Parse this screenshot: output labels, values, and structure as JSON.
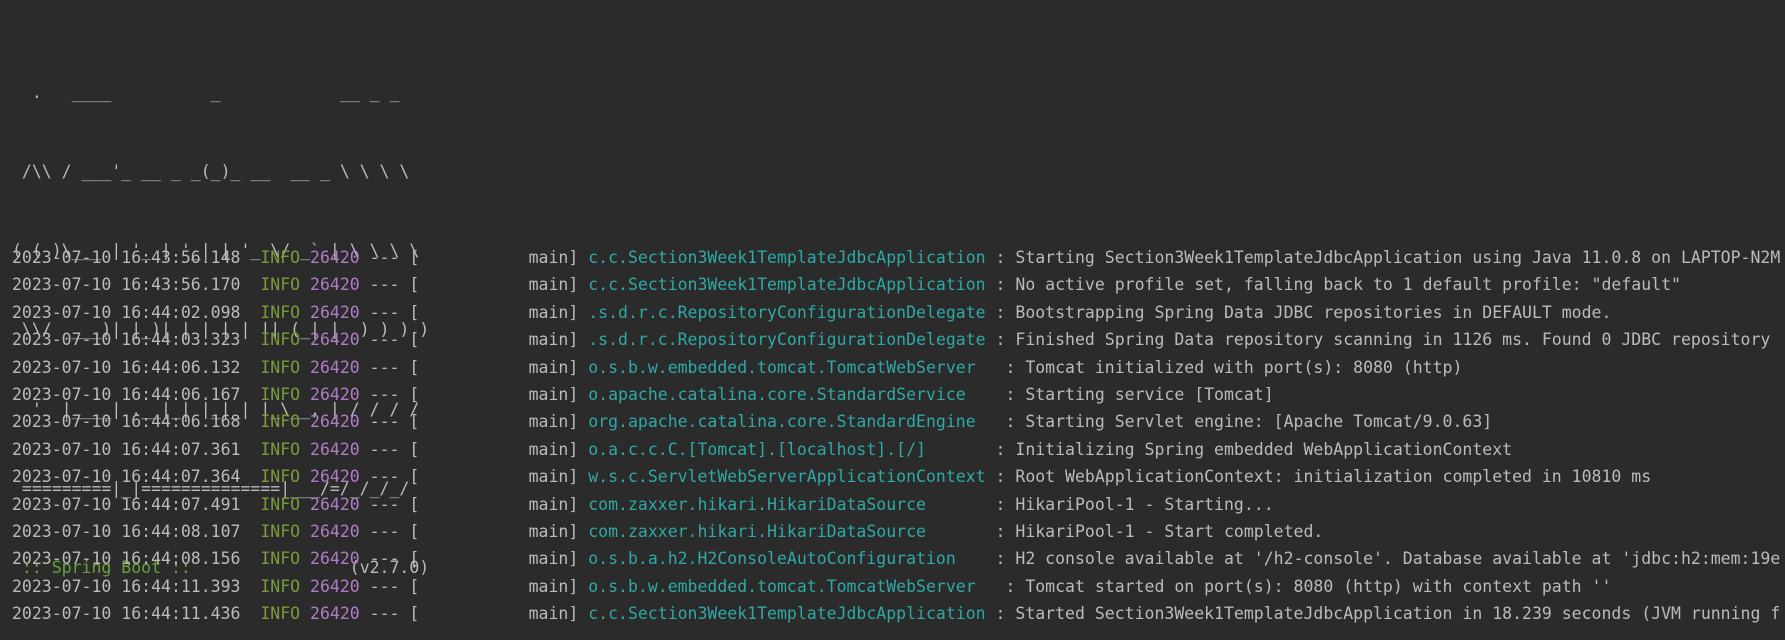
{
  "banner": {
    "lines": [
      "  .   ____          _            __ _ _",
      " /\\\\ / ___'_ __ _ _(_)_ __  __ _ \\ \\ \\ \\",
      "( ( )\\___ | '_ | '_| | '_ \\/ _` | \\ \\ \\ \\",
      " \\\\/  ___)| |_)| | | | | || (_| |  ) ) ) )",
      "  '  |____| .__|_| |_|_| |_\\__, | / / / /",
      " =========|_|==============|___/=/_/_/_/"
    ],
    "spring_label": " :: Spring Boot :: ",
    "spring_version": "               (v2.7.0)"
  },
  "logs": [
    {
      "timestamp": "2023-07-10 16:43:56.148",
      "level": "INFO",
      "pid": "26420",
      "sep": " --- [",
      "thread": "           main] ",
      "logger": "c.c.Section3Week1TemplateJdbcApplication",
      "message": " : Starting Section3Week1TemplateJdbcApplication using Java 11.0.8 on LAPTOP-N2M"
    },
    {
      "timestamp": "2023-07-10 16:43:56.170",
      "level": "INFO",
      "pid": "26420",
      "sep": " --- [",
      "thread": "           main] ",
      "logger": "c.c.Section3Week1TemplateJdbcApplication",
      "message": " : No active profile set, falling back to 1 default profile: \"default\""
    },
    {
      "timestamp": "2023-07-10 16:44:02.098",
      "level": "INFO",
      "pid": "26420",
      "sep": " --- [",
      "thread": "           main] ",
      "logger": ".s.d.r.c.RepositoryConfigurationDelegate",
      "message": " : Bootstrapping Spring Data JDBC repositories in DEFAULT mode."
    },
    {
      "timestamp": "2023-07-10 16:44:03.323",
      "level": "INFO",
      "pid": "26420",
      "sep": " --- [",
      "thread": "           main] ",
      "logger": ".s.d.r.c.RepositoryConfigurationDelegate",
      "message": " : Finished Spring Data repository scanning in 1126 ms. Found 0 JDBC repository"
    },
    {
      "timestamp": "2023-07-10 16:44:06.132",
      "level": "INFO",
      "pid": "26420",
      "sep": " --- [",
      "thread": "           main] ",
      "logger": "o.s.b.w.embedded.tomcat.TomcatWebServer  ",
      "message": " : Tomcat initialized with port(s): 8080 (http)"
    },
    {
      "timestamp": "2023-07-10 16:44:06.167",
      "level": "INFO",
      "pid": "26420",
      "sep": " --- [",
      "thread": "           main] ",
      "logger": "o.apache.catalina.core.StandardService   ",
      "message": " : Starting service [Tomcat]"
    },
    {
      "timestamp": "2023-07-10 16:44:06.168",
      "level": "INFO",
      "pid": "26420",
      "sep": " --- [",
      "thread": "           main] ",
      "logger": "org.apache.catalina.core.StandardEngine  ",
      "message": " : Starting Servlet engine: [Apache Tomcat/9.0.63]"
    },
    {
      "timestamp": "2023-07-10 16:44:07.361",
      "level": "INFO",
      "pid": "26420",
      "sep": " --- [",
      "thread": "           main] ",
      "logger": "o.a.c.c.C.[Tomcat].[localhost].[/]      ",
      "message": " : Initializing Spring embedded WebApplicationContext"
    },
    {
      "timestamp": "2023-07-10 16:44:07.364",
      "level": "INFO",
      "pid": "26420",
      "sep": " --- [",
      "thread": "           main] ",
      "logger": "w.s.c.ServletWebServerApplicationContext",
      "message": " : Root WebApplicationContext: initialization completed in 10810 ms"
    },
    {
      "timestamp": "2023-07-10 16:44:07.491",
      "level": "INFO",
      "pid": "26420",
      "sep": " --- [",
      "thread": "           main] ",
      "logger": "com.zaxxer.hikari.HikariDataSource      ",
      "message": " : HikariPool-1 - Starting..."
    },
    {
      "timestamp": "2023-07-10 16:44:08.107",
      "level": "INFO",
      "pid": "26420",
      "sep": " --- [",
      "thread": "           main] ",
      "logger": "com.zaxxer.hikari.HikariDataSource      ",
      "message": " : HikariPool-1 - Start completed."
    },
    {
      "timestamp": "2023-07-10 16:44:08.156",
      "level": "INFO",
      "pid": "26420",
      "sep": " --- [",
      "thread": "           main] ",
      "logger": "o.s.b.a.h2.H2ConsoleAutoConfiguration   ",
      "message": " : H2 console available at '/h2-console'. Database available at 'jdbc:h2:mem:19e"
    },
    {
      "timestamp": "2023-07-10 16:44:11.393",
      "level": "INFO",
      "pid": "26420",
      "sep": " --- [",
      "thread": "           main] ",
      "logger": "o.s.b.w.embedded.tomcat.TomcatWebServer  ",
      "message": " : Tomcat started on port(s): 8080 (http) with context path ''"
    },
    {
      "timestamp": "2023-07-10 16:44:11.436",
      "level": "INFO",
      "pid": "26420",
      "sep": " --- [",
      "thread": "           main] ",
      "logger": "c.c.Section3Week1TemplateJdbcApplication",
      "message": " : Started Section3Week1TemplateJdbcApplication in 18.239 seconds (JVM running f"
    }
  ]
}
